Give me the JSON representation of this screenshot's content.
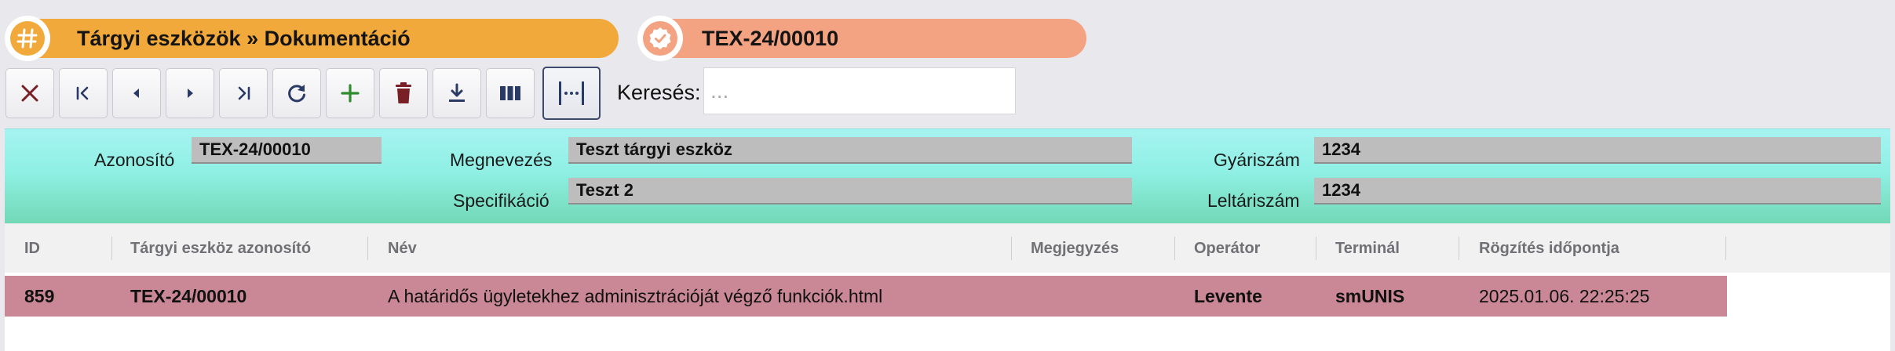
{
  "header": {
    "module_title": "Tárgyi eszközök » Dokumentáció",
    "record_id": "TEX-24/00010",
    "module_color": "#f2a93b",
    "record_color": "#f3a382"
  },
  "toolbar": {
    "buttons": [
      {
        "name": "close-button",
        "icon": "close-icon"
      },
      {
        "name": "first-record-button",
        "icon": "first-icon"
      },
      {
        "name": "previous-record-button",
        "icon": "previous-icon"
      },
      {
        "name": "next-record-button",
        "icon": "next-icon"
      },
      {
        "name": "last-record-button",
        "icon": "last-icon"
      },
      {
        "name": "refresh-button",
        "icon": "refresh-icon"
      },
      {
        "name": "add-button",
        "icon": "plus-icon"
      },
      {
        "name": "delete-button",
        "icon": "trash-icon"
      },
      {
        "name": "download-button",
        "icon": "download-icon"
      },
      {
        "name": "columns-button",
        "icon": "columns-icon"
      },
      {
        "name": "column-width-button",
        "icon": "column-width-icon"
      }
    ],
    "search_label": "Keresés:",
    "search_value": "",
    "search_placeholder": "..."
  },
  "form": {
    "azonosito_label": "Azonosító",
    "azonosito_value": "TEX-24/00010",
    "megnevezes_label": "Megnevezés",
    "megnevezes_value": "Teszt tárgyi eszköz",
    "specifikacio_label": "Specifikáció",
    "specifikacio_value": "Teszt 2",
    "gyariszam_label": "Gyáriszám",
    "gyariszam_value": "1234",
    "leltariszam_label": "Leltáriszám",
    "leltariszam_value": "1234"
  },
  "table": {
    "columns": [
      "ID",
      "Tárgyi eszköz azonosító",
      "Név",
      "Megjegyzés",
      "Operátor",
      "Terminál",
      "Rögzítés időpontja"
    ],
    "rows": [
      {
        "id": "859",
        "asset_id": "TEX-24/00010",
        "name": "A határidős ügyletekhez adminisztrációját végző funkciók.html",
        "note": "",
        "operator": "Levente",
        "terminal": "smUNIS",
        "timestamp": "2025.01.06. 22:25:25"
      }
    ],
    "selected_row_color": "#ca8896"
  }
}
